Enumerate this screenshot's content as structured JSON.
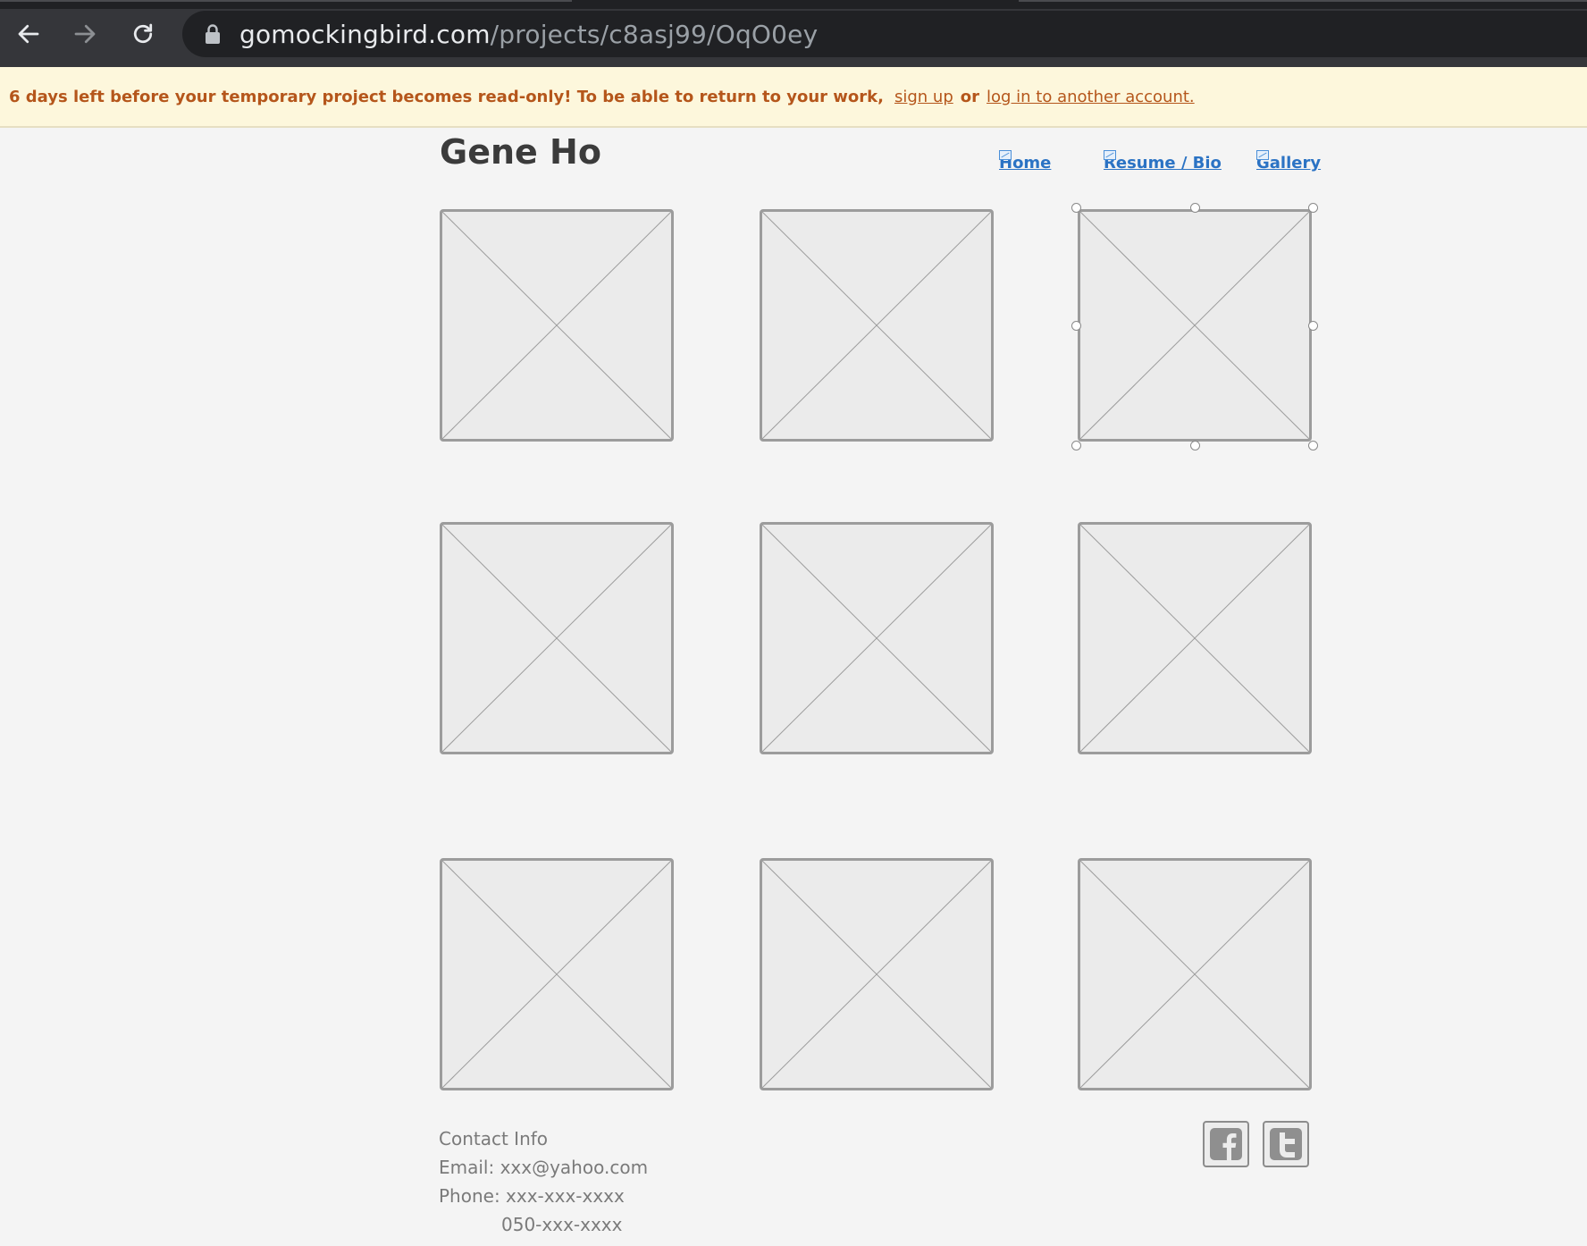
{
  "browser": {
    "url_host": "gomockingbird.com",
    "url_path": "/projects/c8asj99/OqO0ey"
  },
  "notice": {
    "message": "6 days left before your temporary project becomes read-only! To be able to return to your work,",
    "signup_link": "sign up",
    "or_text": "or",
    "login_link": "log in to another account."
  },
  "site": {
    "title": "Gene Ho",
    "nav": [
      {
        "label": "Home"
      },
      {
        "label": "Resume / Bio"
      },
      {
        "label": "Gallery"
      }
    ]
  },
  "gallery": {
    "items": [
      {
        "icon": "image-placeholder-icon"
      },
      {
        "icon": "image-placeholder-icon"
      },
      {
        "icon": "image-placeholder-icon",
        "selected": true
      },
      {
        "icon": "image-placeholder-icon"
      },
      {
        "icon": "image-placeholder-icon"
      },
      {
        "icon": "image-placeholder-icon"
      },
      {
        "icon": "image-placeholder-icon"
      },
      {
        "icon": "image-placeholder-icon"
      },
      {
        "icon": "image-placeholder-icon"
      }
    ]
  },
  "footer": {
    "contact_heading": "Contact Info",
    "email": "Email: xxx@yahoo.com",
    "phone": "Phone: xxx-xxx-xxxx",
    "phone2": "050-xxx-xxxx",
    "social": [
      {
        "icon": "facebook-icon"
      },
      {
        "icon": "twitter-icon"
      }
    ]
  },
  "colors": {
    "notice_text": "#b5561b",
    "notice_bg": "#fdf7dc",
    "link": "#2b73c4",
    "placeholder_border": "#9c9c9c"
  }
}
